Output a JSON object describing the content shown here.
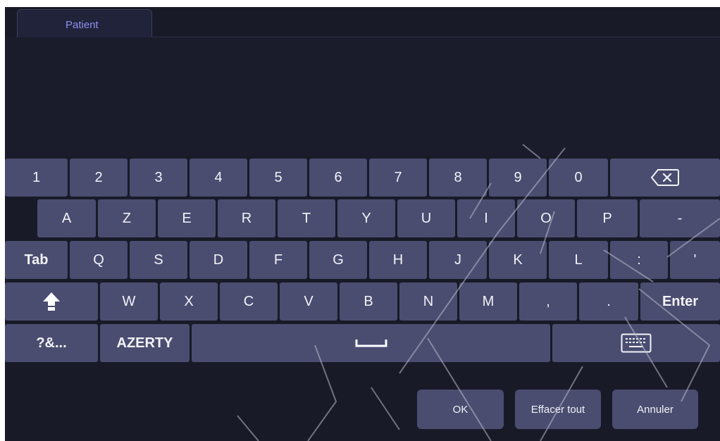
{
  "tab": {
    "label": "Patient"
  },
  "keyboard": {
    "row1": [
      "1",
      "2",
      "3",
      "4",
      "5",
      "6",
      "7",
      "8",
      "9",
      "0"
    ],
    "backspace_icon": "backspace-icon",
    "row2": [
      "A",
      "Z",
      "E",
      "R",
      "T",
      "Y",
      "U",
      "I",
      "O",
      "P",
      "-"
    ],
    "row3": [
      "Tab",
      "Q",
      "S",
      "D",
      "F",
      "G",
      "H",
      "J",
      "K",
      "L",
      ":",
      "'"
    ],
    "shift_icon": "shift-arrow-icon",
    "row4": [
      "W",
      "X",
      "C",
      "V",
      "B",
      "N",
      "M",
      ",",
      "."
    ],
    "enter": "Enter",
    "symbols": "?&...",
    "layout": "AZERTY",
    "space_icon": "space-bar-icon",
    "hide_keyboard_icon": "keyboard-icon"
  },
  "actions": {
    "ok": "OK",
    "clear_all": "Effacer tout",
    "cancel": "Annuler"
  },
  "colors": {
    "background": "#181a27",
    "key": "#4a4d70",
    "accent": "#8f8ff0"
  }
}
